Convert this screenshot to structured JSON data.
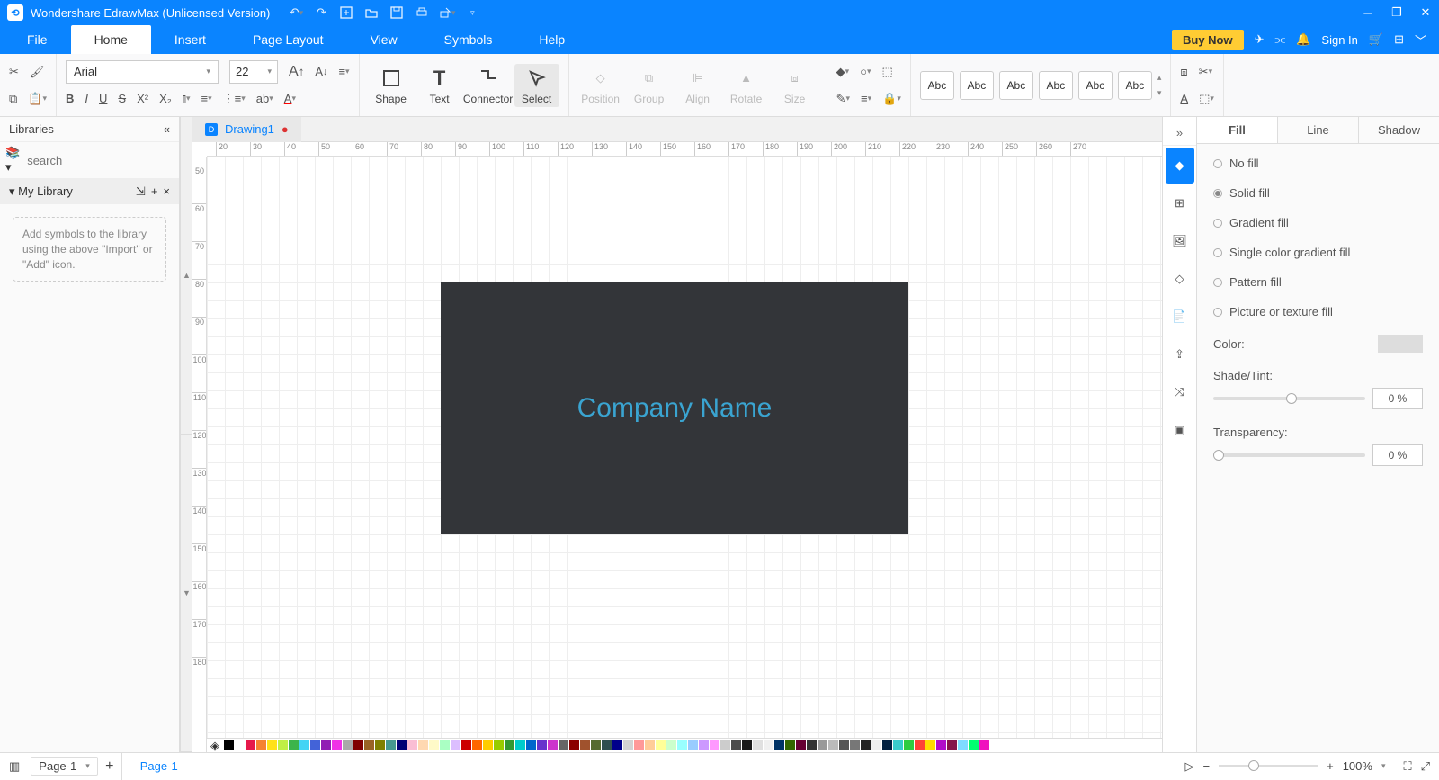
{
  "app": {
    "title": "Wondershare EdrawMax (Unlicensed Version)"
  },
  "menu": {
    "tabs": [
      "File",
      "Home",
      "Insert",
      "Page Layout",
      "View",
      "Symbols",
      "Help"
    ],
    "active": 1,
    "buy": "Buy Now",
    "signin": "Sign In"
  },
  "ribbon": {
    "font_name": "Arial",
    "font_size": "22",
    "shape": "Shape",
    "text": "Text",
    "connector": "Connector",
    "select": "Select",
    "position": "Position",
    "group": "Group",
    "align": "Align",
    "rotate": "Rotate",
    "size": "Size",
    "style_label": "Abc"
  },
  "left": {
    "title": "Libraries",
    "search_placeholder": "search",
    "mylib": "My Library",
    "helper": "Add symbols to the library using the above \"Import\" or \"Add\" icon."
  },
  "doc": {
    "tab": "Drawing1",
    "canvas_text": "Company Name"
  },
  "right": {
    "tabs": [
      "Fill",
      "Line",
      "Shadow"
    ],
    "active": 0,
    "options": [
      "No fill",
      "Solid fill",
      "Gradient fill",
      "Single color gradient fill",
      "Pattern fill",
      "Picture or texture fill"
    ],
    "selected": 1,
    "color_label": "Color:",
    "shade_label": "Shade/Tint:",
    "transparency_label": "Transparency:",
    "shade_val": "0 %",
    "trans_val": "0 %"
  },
  "status": {
    "page_selector": "Page-1",
    "page_tab": "Page-1",
    "zoom": "100%"
  },
  "ruler": {
    "h": [
      "20",
      "30",
      "40",
      "50",
      "60",
      "70",
      "80",
      "90",
      "100",
      "110",
      "120",
      "130",
      "140",
      "150",
      "160",
      "170",
      "180",
      "190",
      "200",
      "210",
      "220",
      "230",
      "240",
      "250",
      "260",
      "270"
    ],
    "v": [
      "50",
      "60",
      "70",
      "80",
      "90",
      "100",
      "110",
      "120",
      "130",
      "140",
      "150",
      "160",
      "170",
      "180"
    ]
  },
  "palette": [
    "#000",
    "#fff",
    "#e6194b",
    "#f58231",
    "#ffe119",
    "#bfef45",
    "#3cb44b",
    "#42d4f4",
    "#4363d8",
    "#911eb4",
    "#f032e6",
    "#a9a9a9",
    "#800000",
    "#9a6324",
    "#808000",
    "#469990",
    "#000075",
    "#fabed4",
    "#ffd8b1",
    "#fffac8",
    "#aaffc3",
    "#dcbeff",
    "#cc0000",
    "#ff6600",
    "#ffcc00",
    "#99cc00",
    "#339933",
    "#00cccc",
    "#0066cc",
    "#6633cc",
    "#cc33cc",
    "#666",
    "#8b0000",
    "#a0522d",
    "#556b2f",
    "#2f4f4f",
    "#00008b",
    "#d3d3d3",
    "#ff9999",
    "#ffcc99",
    "#ffff99",
    "#ccffcc",
    "#99ffff",
    "#99ccff",
    "#cc99ff",
    "#ff99ff",
    "#ccc",
    "#4d4d4d",
    "#1a1a1a",
    "#e0e0e0",
    "#f0f0f0",
    "#003366",
    "#336600",
    "#660033",
    "#333",
    "#999",
    "#bbb",
    "#555",
    "#777",
    "#222",
    "#eee",
    "#001f3f",
    "#39cccc",
    "#2ecc40",
    "#ff4136",
    "#ffdc00",
    "#b10dc9",
    "#85144b",
    "#7fdbff",
    "#01ff70",
    "#f012be"
  ]
}
